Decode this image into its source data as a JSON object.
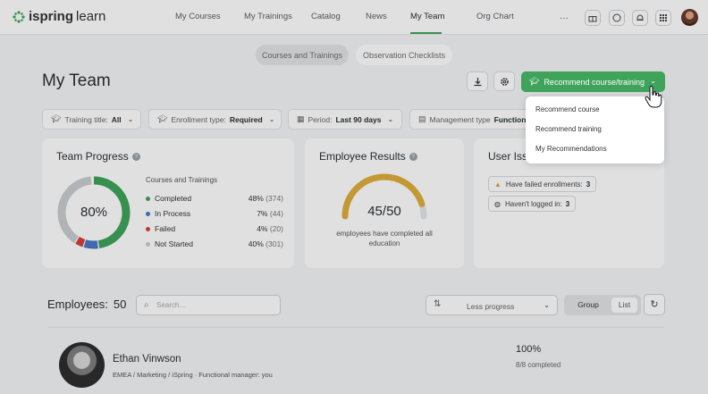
{
  "brand": {
    "name_a": "ispring",
    "name_b": "learn"
  },
  "nav": [
    {
      "label": "My Courses"
    },
    {
      "label": "My Trainings"
    },
    {
      "label": "Catalog"
    },
    {
      "label": "News"
    },
    {
      "label": "My Team",
      "active": true
    },
    {
      "label": "Org Chart"
    }
  ],
  "topbar_icons": [
    "more-icon",
    "gift-icon",
    "chat-icon",
    "bell-icon",
    "apps-grid-icon"
  ],
  "segments": {
    "active": "Courses and Trainings",
    "other": "Observation Checklists"
  },
  "page_title": "My Team",
  "actions": {
    "primary": "Recommend course/training"
  },
  "filters": {
    "training_title": {
      "label": "Training title:",
      "value": "All"
    },
    "enrollment_type": {
      "label": "Enrollment type:",
      "value": "Required"
    },
    "period": {
      "label": "Period:",
      "value": "Last 90 days"
    },
    "management_type": {
      "label": "Management type",
      "value": "Function"
    }
  },
  "team_progress": {
    "title": "Team Progress",
    "center": "80%",
    "subtitle": "Courses and Trainings",
    "rows": [
      {
        "label": "Completed",
        "pct": "48%",
        "count": "(374)",
        "color": "#3fa35c"
      },
      {
        "label": "In Process",
        "pct": "7%",
        "count": "(44)",
        "color": "#4a78c8"
      },
      {
        "label": "Failed",
        "pct": "4%",
        "count": "(20)",
        "color": "#d6413b"
      },
      {
        "label": "Not Started",
        "pct": "40%",
        "count": "(301)",
        "color": "#c9cdd1"
      }
    ]
  },
  "employee_results": {
    "title": "Employee Results",
    "value": "45/50",
    "fraction": 0.9,
    "caption": "employees have completed all education",
    "color": "#e0ad3c"
  },
  "user_issues": {
    "title": "User Iss",
    "items": [
      {
        "label": "Have failed enrollments:",
        "count": "3"
      },
      {
        "label": "Haven't logged in:",
        "count": "3"
      }
    ]
  },
  "dropdown": [
    {
      "label": "Recommend course"
    },
    {
      "label": "Recommend training"
    },
    {
      "label": "My Recommendations"
    }
  ],
  "employees": {
    "label": "Employees:",
    "count": "50",
    "search_placeholder": "Search...",
    "sort": "Less progress",
    "group": "Group",
    "list": "List"
  },
  "employee_row": {
    "name": "Ethan Vinwson",
    "meta": "EMEA / Marketing / iSpring · Functional manager: you",
    "pct": "100%",
    "done": "8/8 completed"
  }
}
